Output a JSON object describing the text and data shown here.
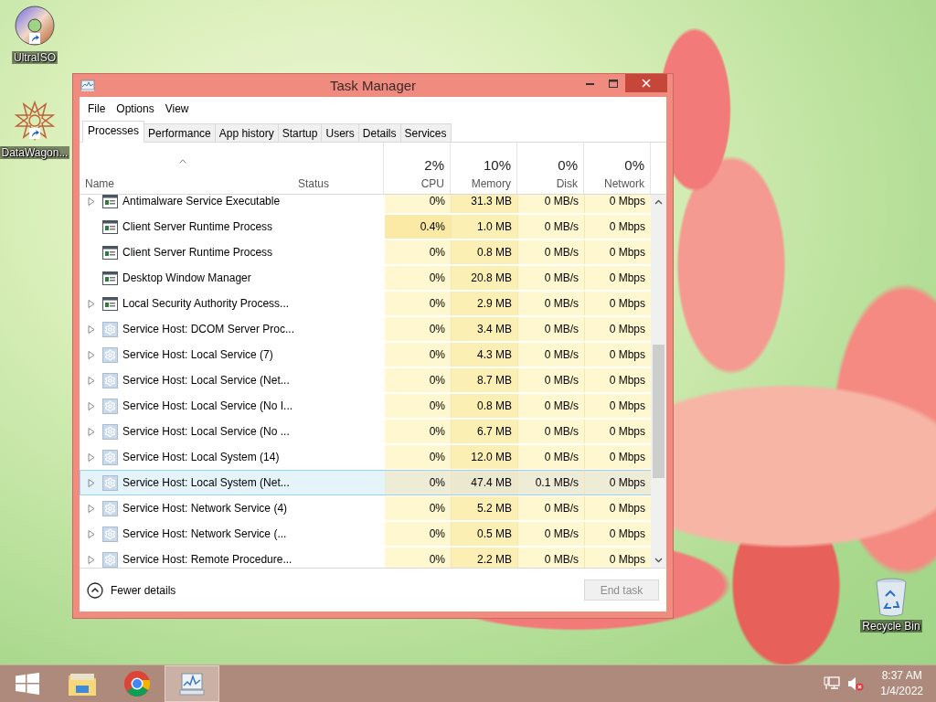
{
  "desktop_icons": [
    {
      "label": "UltraISO",
      "kind": "disc"
    },
    {
      "label": "DataWagon...",
      "kind": "star"
    }
  ],
  "recycle_bin": {
    "label": "Recycle Bin"
  },
  "window": {
    "title": "Task Manager"
  },
  "menu": [
    "File",
    "Options",
    "View"
  ],
  "tabs": [
    {
      "label": "Processes",
      "selected": true
    },
    {
      "label": "Performance",
      "selected": false
    },
    {
      "label": "App history",
      "selected": false
    },
    {
      "label": "Startup",
      "selected": false
    },
    {
      "label": "Users",
      "selected": false
    },
    {
      "label": "Details",
      "selected": false
    },
    {
      "label": "Services",
      "selected": false
    }
  ],
  "columns": [
    {
      "label": "Name",
      "kind": "text",
      "sorted": true
    },
    {
      "label": "Status",
      "kind": "text",
      "sorted": false
    },
    {
      "label": "CPU",
      "kind": "metric",
      "total": "2%"
    },
    {
      "label": "Memory",
      "kind": "metric",
      "total": "10%"
    },
    {
      "label": "Disk",
      "kind": "metric",
      "total": "0%"
    },
    {
      "label": "Network",
      "kind": "metric",
      "total": "0%"
    }
  ],
  "rows": [
    {
      "name": "Antimalware Service Executable",
      "kind": "app",
      "expandable": true,
      "selected": false,
      "cpu_busy": false,
      "cpu": "0%",
      "memory": "31.3 MB",
      "disk": "0 MB/s",
      "network": "0 Mbps"
    },
    {
      "name": "Client Server Runtime Process",
      "kind": "app",
      "expandable": false,
      "selected": false,
      "cpu_busy": true,
      "cpu": "0.4%",
      "memory": "1.0 MB",
      "disk": "0 MB/s",
      "network": "0 Mbps"
    },
    {
      "name": "Client Server Runtime Process",
      "kind": "app",
      "expandable": false,
      "selected": false,
      "cpu_busy": false,
      "cpu": "0%",
      "memory": "0.8 MB",
      "disk": "0 MB/s",
      "network": "0 Mbps"
    },
    {
      "name": "Desktop Window Manager",
      "kind": "app",
      "expandable": false,
      "selected": false,
      "cpu_busy": false,
      "cpu": "0%",
      "memory": "20.8 MB",
      "disk": "0 MB/s",
      "network": "0 Mbps"
    },
    {
      "name": "Local Security Authority Process...",
      "kind": "app",
      "expandable": true,
      "selected": false,
      "cpu_busy": false,
      "cpu": "0%",
      "memory": "2.9 MB",
      "disk": "0 MB/s",
      "network": "0 Mbps"
    },
    {
      "name": "Service Host: DCOM Server Proc...",
      "kind": "service",
      "expandable": true,
      "selected": false,
      "cpu_busy": false,
      "cpu": "0%",
      "memory": "3.4 MB",
      "disk": "0 MB/s",
      "network": "0 Mbps"
    },
    {
      "name": "Service Host: Local Service (7)",
      "kind": "service",
      "expandable": true,
      "selected": false,
      "cpu_busy": false,
      "cpu": "0%",
      "memory": "4.3 MB",
      "disk": "0 MB/s",
      "network": "0 Mbps"
    },
    {
      "name": "Service Host: Local Service (Net...",
      "kind": "service",
      "expandable": true,
      "selected": false,
      "cpu_busy": false,
      "cpu": "0%",
      "memory": "8.7 MB",
      "disk": "0 MB/s",
      "network": "0 Mbps"
    },
    {
      "name": "Service Host: Local Service (No I...",
      "kind": "service",
      "expandable": true,
      "selected": false,
      "cpu_busy": false,
      "cpu": "0%",
      "memory": "0.8 MB",
      "disk": "0 MB/s",
      "network": "0 Mbps"
    },
    {
      "name": "Service Host: Local Service (No ...",
      "kind": "service",
      "expandable": true,
      "selected": false,
      "cpu_busy": false,
      "cpu": "0%",
      "memory": "6.7 MB",
      "disk": "0 MB/s",
      "network": "0 Mbps"
    },
    {
      "name": "Service Host: Local System (14)",
      "kind": "service",
      "expandable": true,
      "selected": false,
      "cpu_busy": false,
      "cpu": "0%",
      "memory": "12.0 MB",
      "disk": "0 MB/s",
      "network": "0 Mbps"
    },
    {
      "name": "Service Host: Local System (Net...",
      "kind": "service",
      "expandable": true,
      "selected": true,
      "cpu_busy": false,
      "cpu": "0%",
      "memory": "47.4 MB",
      "disk": "0.1 MB/s",
      "network": "0 Mbps"
    },
    {
      "name": "Service Host: Network Service (4)",
      "kind": "service",
      "expandable": true,
      "selected": false,
      "cpu_busy": false,
      "cpu": "0%",
      "memory": "5.2 MB",
      "disk": "0 MB/s",
      "network": "0 Mbps"
    },
    {
      "name": "Service Host: Network Service (...",
      "kind": "service",
      "expandable": true,
      "selected": false,
      "cpu_busy": false,
      "cpu": "0%",
      "memory": "0.5 MB",
      "disk": "0 MB/s",
      "network": "0 Mbps"
    },
    {
      "name": "Service Host: Remote Procedure...",
      "kind": "service",
      "expandable": true,
      "selected": false,
      "cpu_busy": false,
      "cpu": "0%",
      "memory": "2.2 MB",
      "disk": "0 MB/s",
      "network": "0 Mbps"
    }
  ],
  "footer": {
    "details_toggle": "Fewer details",
    "end_task": {
      "label": "End task",
      "disabled": true
    }
  },
  "taskbar": {
    "apps": [
      {
        "kind": "explorer",
        "active": false
      },
      {
        "kind": "chrome",
        "active": false
      },
      {
        "kind": "taskmgr",
        "active": true
      }
    ],
    "tray": {
      "volume_muted": true,
      "time": "8:37 AM",
      "date": "1/4/2022"
    }
  }
}
